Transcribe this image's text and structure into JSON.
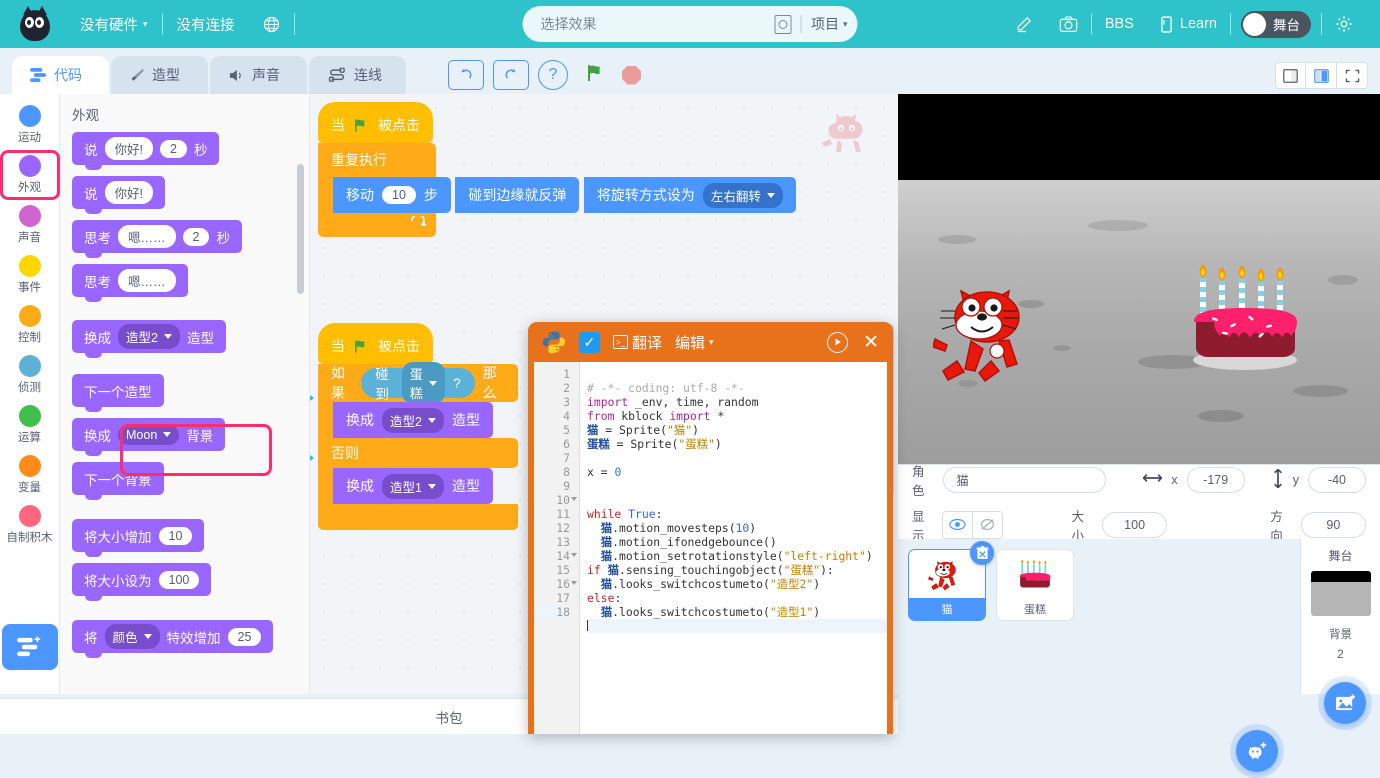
{
  "topbar": {
    "hardware": "没有硬件",
    "connection": "没有连接",
    "globe_icon": "globe-icon",
    "search_placeholder": "选择效果",
    "project": "项目",
    "edit_icon": "pencil-icon",
    "camera_icon": "camera-icon",
    "bbs": "BBS",
    "learn": "Learn",
    "stage_toggle": "舞台",
    "settings_icon": "gear-icon"
  },
  "tabs": [
    {
      "label": "代码",
      "icon": "code-blocks-icon",
      "active": true
    },
    {
      "label": "造型",
      "icon": "paintbrush-icon",
      "active": false
    },
    {
      "label": "声音",
      "icon": "speaker-icon",
      "active": false
    },
    {
      "label": "连线",
      "icon": "wire-icon",
      "active": false
    }
  ],
  "toolbar": {
    "undo": "undo-icon",
    "redo": "redo-icon",
    "help": "?",
    "green_flag": "green-flag-icon",
    "stop": "stop-icon",
    "layout_small": "layout-small-icon",
    "layout_large": "layout-large-icon",
    "fullscreen": "fullscreen-icon"
  },
  "categories": [
    {
      "label": "运动",
      "color": "#4c97ff",
      "selected": false
    },
    {
      "label": "外观",
      "color": "#9966ff",
      "selected": true
    },
    {
      "label": "声音",
      "color": "#cf63cf",
      "selected": false
    },
    {
      "label": "事件",
      "color": "#ffd500",
      "selected": false
    },
    {
      "label": "控制",
      "color": "#ffab19",
      "selected": false
    },
    {
      "label": "侦测",
      "color": "#5cb1d6",
      "selected": false
    },
    {
      "label": "运算",
      "color": "#40bf4a",
      "selected": false
    },
    {
      "label": "变量",
      "color": "#ff8c1a",
      "selected": false
    },
    {
      "label": "自制积木",
      "color": "#ff6680",
      "selected": false
    }
  ],
  "add_extension_icon": "add-extension-icon",
  "palette": {
    "title": "外观",
    "blocks": [
      {
        "id": "say_secs",
        "parts": [
          {
            "t": "label",
            "v": "说"
          },
          {
            "t": "oval",
            "v": "你好!"
          },
          {
            "t": "oval",
            "v": "2"
          },
          {
            "t": "label",
            "v": "秒"
          }
        ]
      },
      {
        "id": "say",
        "parts": [
          {
            "t": "label",
            "v": "说"
          },
          {
            "t": "oval",
            "v": "你好!"
          }
        ]
      },
      {
        "id": "think_secs",
        "parts": [
          {
            "t": "label",
            "v": "思考"
          },
          {
            "t": "oval",
            "v": "嗯……"
          },
          {
            "t": "oval",
            "v": "2"
          },
          {
            "t": "label",
            "v": "秒"
          }
        ]
      },
      {
        "id": "think",
        "parts": [
          {
            "t": "label",
            "v": "思考"
          },
          {
            "t": "oval",
            "v": "嗯……"
          }
        ]
      },
      {
        "id": "switch_costume",
        "highlighted": true,
        "parts": [
          {
            "t": "label",
            "v": "换成"
          },
          {
            "t": "drop",
            "v": "造型2"
          },
          {
            "t": "label",
            "v": "造型"
          }
        ]
      },
      {
        "id": "next_costume",
        "parts": [
          {
            "t": "label",
            "v": "下一个造型"
          }
        ]
      },
      {
        "id": "switch_backdrop",
        "parts": [
          {
            "t": "label",
            "v": "换成"
          },
          {
            "t": "drop",
            "v": "Moon"
          },
          {
            "t": "label",
            "v": "背景"
          }
        ]
      },
      {
        "id": "next_backdrop",
        "parts": [
          {
            "t": "label",
            "v": "下一个背景"
          }
        ]
      },
      {
        "id": "change_size",
        "parts": [
          {
            "t": "label",
            "v": "将大小增加"
          },
          {
            "t": "oval",
            "v": "10"
          }
        ]
      },
      {
        "id": "set_size",
        "parts": [
          {
            "t": "label",
            "v": "将大小设为"
          },
          {
            "t": "oval",
            "v": "100"
          }
        ]
      },
      {
        "id": "change_effect",
        "parts": [
          {
            "t": "label",
            "v": "将"
          },
          {
            "t": "drop",
            "v": "颜色"
          },
          {
            "t": "label",
            "v": "特效增加"
          },
          {
            "t": "oval",
            "v": "25"
          }
        ]
      }
    ]
  },
  "script1": {
    "hat": {
      "pre": "当",
      "post": "被点击",
      "icon": "green-flag-icon"
    },
    "repeat": "重复执行",
    "move_pre": "移动",
    "move_val": "10",
    "move_post": "步",
    "bounce": "碰到边缘就反弹",
    "rotstyle_pre": "将旋转方式设为",
    "rotstyle_val": "左右翻转"
  },
  "script2": {
    "hat": {
      "pre": "当",
      "post": "被点击",
      "icon": "green-flag-icon"
    },
    "if_pre": "如果",
    "touch": "碰到",
    "touch_target": "蛋糕",
    "qmark": "?",
    "if_post": "那么",
    "then_pre": "换成",
    "then_val": "造型2",
    "then_post": "造型",
    "else_label": "否则",
    "else_pre": "换成",
    "else_val": "造型1",
    "else_post": "造型"
  },
  "pywin": {
    "logo": "python-logo-icon",
    "check_icon": "checkbox-checked-icon",
    "terminal_icon": "terminal-icon",
    "translate": "翻译",
    "edit": "编辑",
    "run_icon": "run-icon",
    "close_icon": "close-icon",
    "lines": [
      {
        "n": 1,
        "fold": false
      },
      {
        "n": 2,
        "fold": false
      },
      {
        "n": 3,
        "fold": false
      },
      {
        "n": 4,
        "fold": false
      },
      {
        "n": 5,
        "fold": false
      },
      {
        "n": 6,
        "fold": false
      },
      {
        "n": 7,
        "fold": false
      },
      {
        "n": 8,
        "fold": false
      },
      {
        "n": 9,
        "fold": false
      },
      {
        "n": 10,
        "fold": true
      },
      {
        "n": 11,
        "fold": false
      },
      {
        "n": 12,
        "fold": false
      },
      {
        "n": 13,
        "fold": false
      },
      {
        "n": 14,
        "fold": true
      },
      {
        "n": 15,
        "fold": false
      },
      {
        "n": 16,
        "fold": true
      },
      {
        "n": 17,
        "fold": false
      },
      {
        "n": 18,
        "fold": false
      }
    ],
    "code": [
      "# -*- coding: utf-8 -*-",
      "import _env, time, random",
      "from kblock import *",
      "猫 = Sprite(\"猫\")",
      "蛋糕 = Sprite(\"蛋糕\")",
      "",
      "x = 0",
      "",
      "",
      "while True:",
      "  猫.motion_movesteps(10)",
      "  猫.motion_ifonedgebounce()",
      "  猫.motion_setrotationstyle(\"left-right\")",
      "if 猫.sensing_touchingobject(\"蛋糕\"):",
      "  猫.looks_switchcostumeto(\"造型2\")",
      "else:",
      "  猫.looks_switchcostumeto(\"造型1\")",
      ""
    ]
  },
  "sprite_info": {
    "name_label": "角色",
    "name_value": "猫",
    "x_label": "x",
    "x_value": "-179",
    "y_label": "y",
    "y_value": "-40",
    "show_label": "显示",
    "size_label": "大小",
    "size_value": "100",
    "dir_label": "方向",
    "dir_value": "90"
  },
  "sprites": [
    {
      "name": "猫",
      "selected": true,
      "icon": "cat-sprite-icon"
    },
    {
      "name": "蛋糕",
      "selected": false,
      "icon": "cake-sprite-icon"
    }
  ],
  "stage_panel": {
    "title": "舞台",
    "backdrop_label": "背景",
    "backdrop_count": "2"
  },
  "fabs": {
    "add_sprite": "add-sprite-icon",
    "add_backdrop": "add-backdrop-icon"
  },
  "backpack": {
    "label": "书包"
  },
  "colors": {
    "brand": "#2ec2cb",
    "accent": "#4c97ff",
    "looks": "#9966ff",
    "motion": "#4c97ff",
    "control": "#ffab19",
    "events": "#ffbf00",
    "sensing": "#5cb1d6",
    "highlight": "#ff2d6f",
    "python": "#e8721c"
  }
}
